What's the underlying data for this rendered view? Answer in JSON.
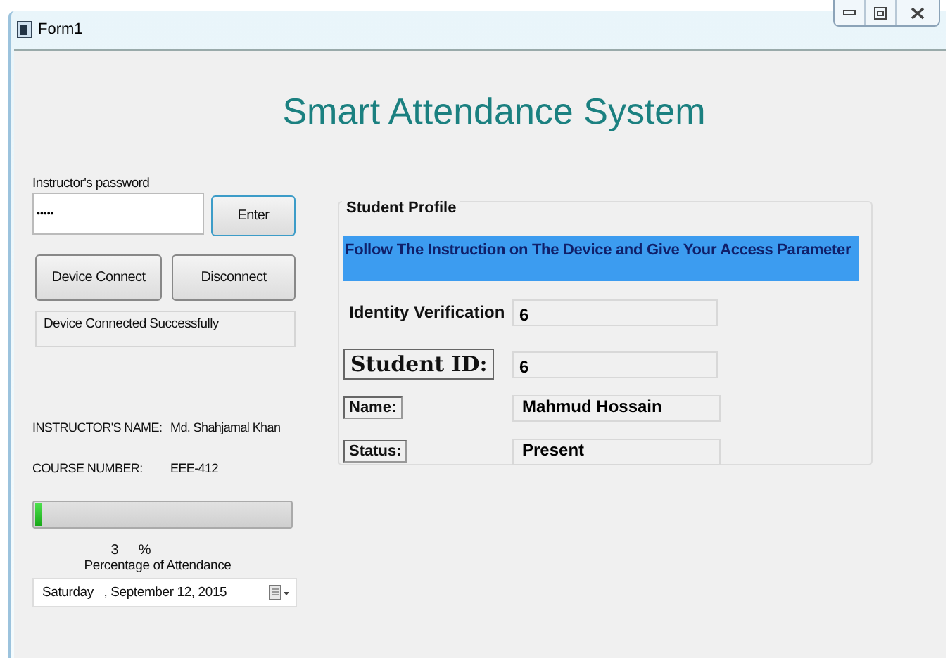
{
  "window": {
    "title": "Form1"
  },
  "heading": "Smart Attendance System",
  "password": {
    "label": "Instructor's password",
    "value": "•••••"
  },
  "buttons": {
    "enter": "Enter",
    "connect": "Device Connect",
    "disconnect": "Disconnect"
  },
  "status_message": "Device Connected Successfully",
  "info": [
    {
      "label": "INSTRUCTOR'S NAME:",
      "value": "Md. Shahjamal Khan"
    },
    {
      "label": "COURSE NUMBER:",
      "value": "EEE-412"
    }
  ],
  "attendance": {
    "level": 0.03,
    "percent": "3",
    "percent_sign": "%",
    "caption": "Percentage of Attendance"
  },
  "date": {
    "value": "Saturday   , September 12, 2015"
  },
  "profile": {
    "title": "Student Profile",
    "banner": "Follow The Instruction on The Device and Give Your Access Parameter",
    "rows": [
      {
        "kind": "plain",
        "label": "Identity Verification",
        "value": "6"
      },
      {
        "kind": "boxed-large",
        "label": "Student ID:",
        "value": "6"
      },
      {
        "kind": "boxed",
        "label": "Name:",
        "value": "Mahmud Hossain"
      },
      {
        "kind": "boxed",
        "label": "Status:",
        "value": "Present"
      }
    ]
  }
}
